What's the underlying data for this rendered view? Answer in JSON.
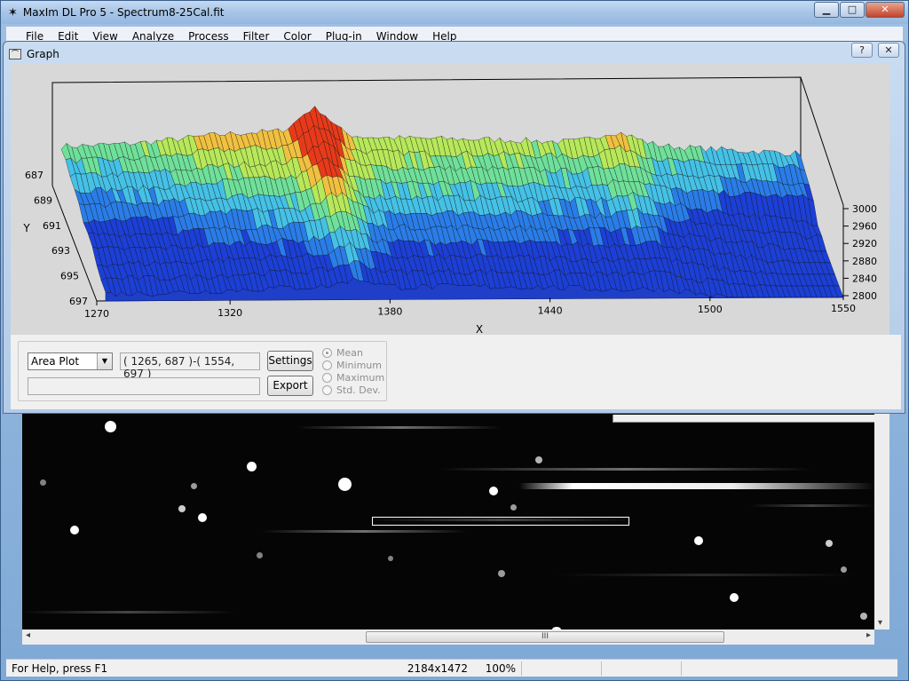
{
  "window": {
    "title": "MaxIm DL Pro 5 - Spectrum8-25Cal.fit",
    "minimize_glyph": "▁",
    "maximize_glyph": "□",
    "close_glyph": "✕"
  },
  "menu": {
    "items": [
      "File",
      "Edit",
      "View",
      "Analyze",
      "Process",
      "Filter",
      "Color",
      "Plug-in",
      "Window",
      "Help"
    ]
  },
  "graph": {
    "title": "Graph",
    "help_glyph": "?",
    "close_glyph": "✕",
    "plot_type": "Area Plot",
    "coords": "( 1265, 687 )-( 1554, 697 )",
    "settings_label": "Settings",
    "export_label": "Export",
    "stat_options": [
      {
        "label": "Mean",
        "selected": true
      },
      {
        "label": "Minimum",
        "selected": false
      },
      {
        "label": "Maximum",
        "selected": false
      },
      {
        "label": "Std. Dev.",
        "selected": false
      }
    ]
  },
  "chart_data": {
    "type": "surface",
    "title": "",
    "xlabel": "X",
    "ylabel": "Y",
    "zlabel": "",
    "x_ticks": [
      "1270",
      "1320",
      "1380",
      "1440",
      "1500",
      "1550"
    ],
    "y_ticks": [
      "687",
      "689",
      "691",
      "693",
      "695",
      "697"
    ],
    "z_ticks": [
      "3000",
      "2960",
      "2920",
      "2880",
      "2840",
      "2800"
    ],
    "xlim": [
      1270,
      1550
    ],
    "ylim": [
      687,
      697
    ],
    "zlim": [
      2800,
      3000
    ],
    "colormap": [
      "#1c3fd6",
      "#2a7de8",
      "#45c1e6",
      "#6fe09a",
      "#b7e85a",
      "#f0c040",
      "#e83a1a"
    ]
  },
  "image": {
    "hscroll_grip": "III",
    "vscroll_down": "▾"
  },
  "status": {
    "help_text": "For Help, press F1",
    "dimensions": "2184x1472",
    "zoom": "100%"
  }
}
